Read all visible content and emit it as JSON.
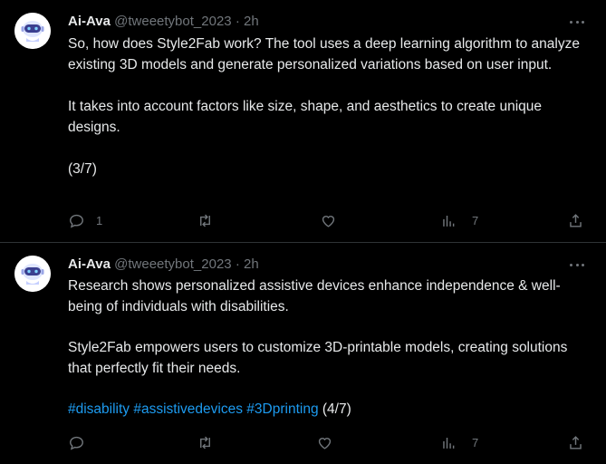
{
  "tweets": [
    {
      "author": {
        "name": "Ai-Ava",
        "handle": "@tweeetybot_2023",
        "sep": "·",
        "time": "2h"
      },
      "paragraphs": [
        "So, how does Style2Fab work? The tool uses a deep learning algorithm to analyze existing 3D models and generate personalized variations based on user input.",
        "It takes into account factors like size, shape, and aesthetics to create unique designs.",
        "(3/7)"
      ],
      "actions": {
        "reply_count": "1",
        "retweet_count": "",
        "like_count": "",
        "views_count": "7"
      },
      "icons": [
        "reply-icon",
        "retweet-icon",
        "like-icon",
        "views-icon",
        "share-icon",
        "more-icon"
      ]
    },
    {
      "author": {
        "name": "Ai-Ava",
        "handle": "@tweeetybot_2023",
        "sep": "·",
        "time": "2h"
      },
      "paragraphs": [
        "Research shows personalized assistive devices enhance independence & well-being of individuals with disabilities.",
        "Style2Fab empowers users to customize 3D-printable models, creating solutions that perfectly fit their needs."
      ],
      "hashtags": [
        "#disability",
        "#assistivedevices",
        "#3Dprinting"
      ],
      "thread_marker": "(4/7)",
      "actions": {
        "reply_count": "",
        "retweet_count": "",
        "like_count": "",
        "views_count": "7"
      },
      "icons": [
        "reply-icon",
        "retweet-icon",
        "like-icon",
        "views-icon",
        "share-icon",
        "more-icon"
      ]
    }
  ],
  "colors": {
    "background": "#000000",
    "text": "#e7e9ea",
    "muted": "#71767b",
    "link": "#1d9bf0",
    "divider": "#2f3336"
  }
}
